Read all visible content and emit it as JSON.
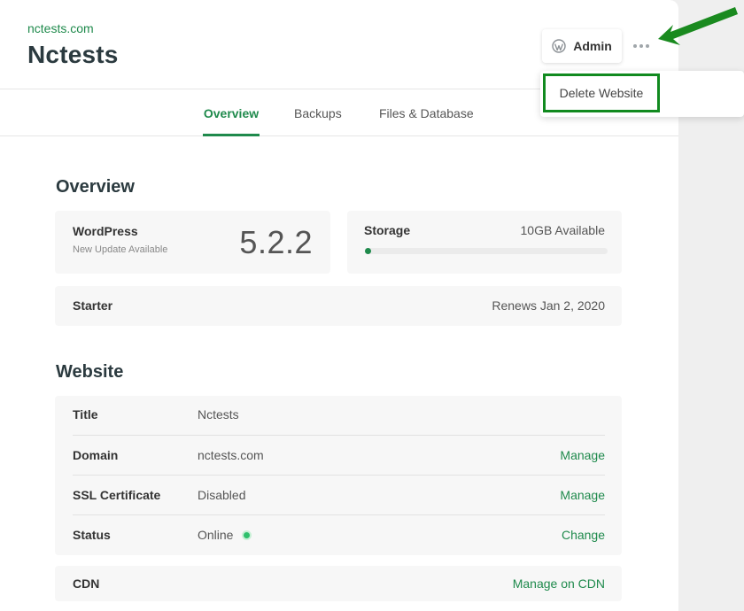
{
  "header": {
    "domain": "nctests.com",
    "title": "Nctests",
    "admin_label": "Admin"
  },
  "menu": {
    "delete_website": "Delete Website"
  },
  "tabs": [
    {
      "label": "Overview",
      "active": true
    },
    {
      "label": "Backups",
      "active": false
    },
    {
      "label": "Files & Database",
      "active": false
    }
  ],
  "overview": {
    "title": "Overview",
    "wordpress": {
      "label": "WordPress",
      "sub": "New Update Available",
      "version": "5.2.2"
    },
    "storage": {
      "label": "Storage",
      "available": "10GB Available",
      "used_fraction": 0.02
    },
    "plan": {
      "label": "Starter",
      "renews": "Renews Jan 2, 2020"
    }
  },
  "website": {
    "title": "Website",
    "rows": [
      {
        "label": "Title",
        "value": "Nctests",
        "action": ""
      },
      {
        "label": "Domain",
        "value": "nctests.com",
        "action": "Manage"
      },
      {
        "label": "SSL Certificate",
        "value": "Disabled",
        "action": "Manage"
      },
      {
        "label": "Status",
        "value": "Online",
        "action": "Change"
      }
    ],
    "cdn": {
      "label": "CDN",
      "action": "Manage on CDN"
    }
  },
  "colors": {
    "accent": "#1f8a4c",
    "highlight_border": "#118a1f",
    "status_online": "#2ec06c"
  },
  "icons": {
    "admin": "wordpress-icon",
    "more": "more-horizontal-icon",
    "annotation": "arrow-annotation-icon"
  }
}
